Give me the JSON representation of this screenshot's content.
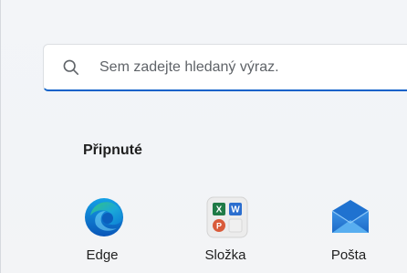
{
  "search": {
    "placeholder": "Sem zadejte hledaný výraz."
  },
  "pinned": {
    "title": "Připnuté",
    "apps": [
      {
        "label": "Edge",
        "icon": "edge-icon"
      },
      {
        "label": "Složka",
        "icon": "office-folder-icon"
      },
      {
        "label": "Pošta",
        "icon": "mail-icon"
      }
    ]
  },
  "colors": {
    "accent": "#0f62c9",
    "edge_blue": "#0c7fd6",
    "edge_green": "#2fbf6f",
    "mail_blue": "#2c7fd0"
  }
}
